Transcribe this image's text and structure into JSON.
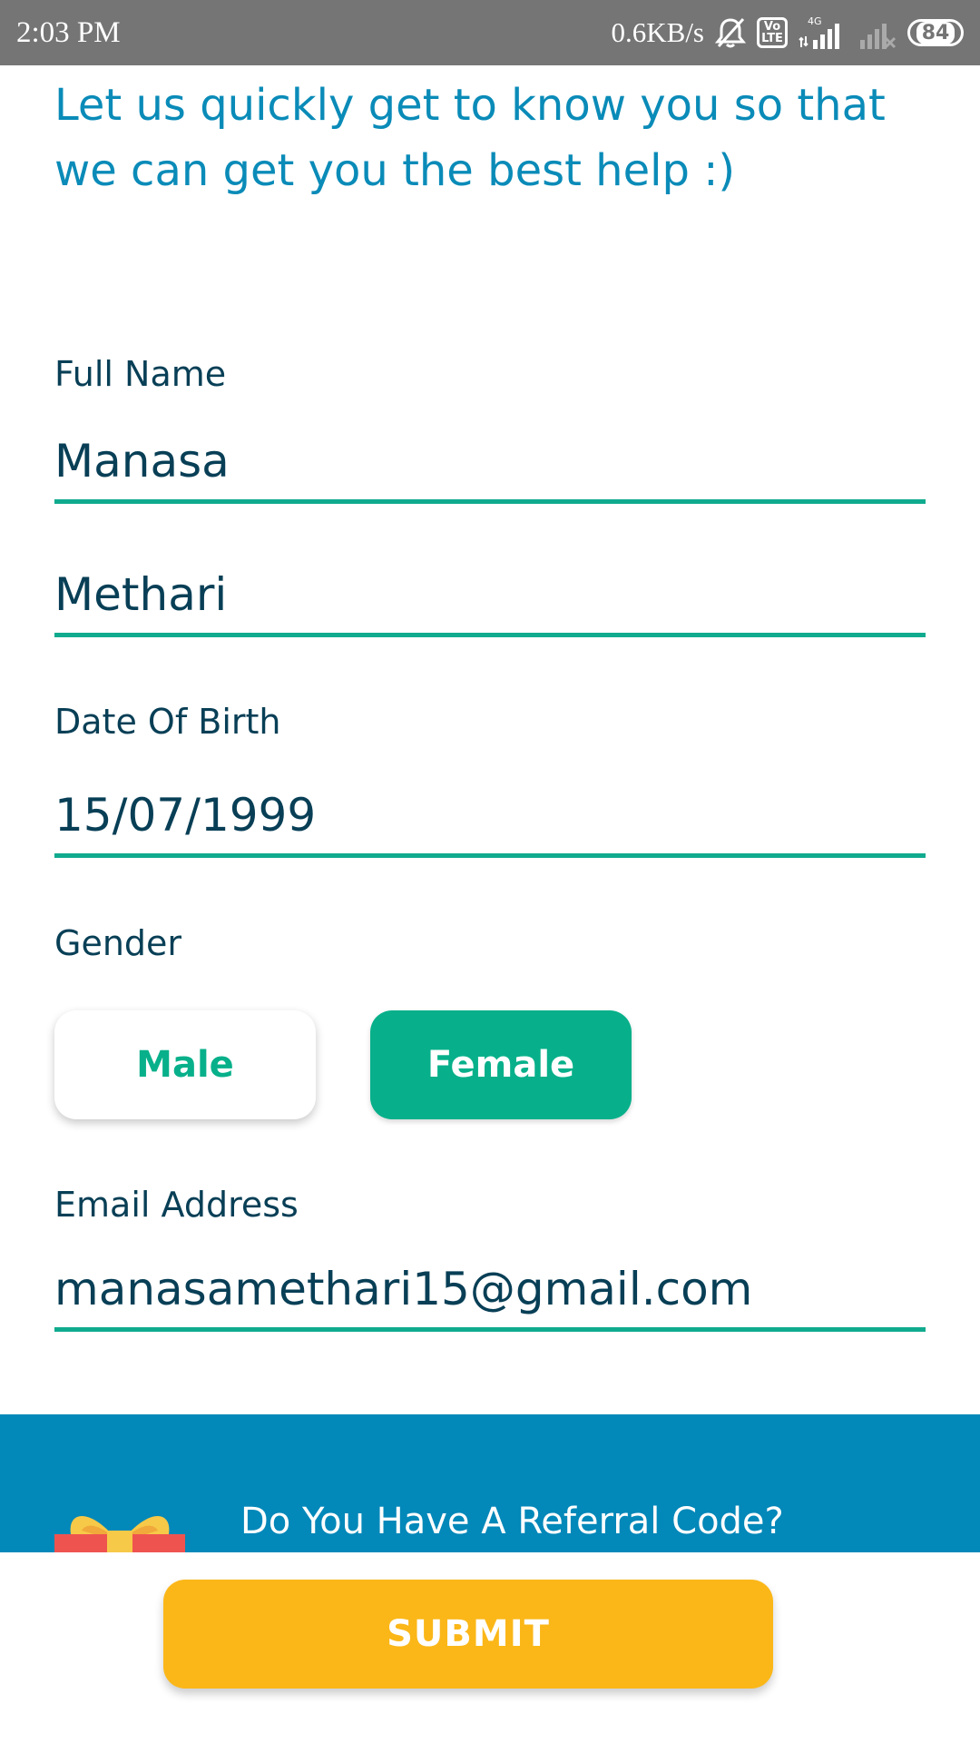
{
  "status_bar": {
    "time": "2:03 PM",
    "net_speed": "0.6KB/s",
    "network_type": "4G",
    "volte_top": "Vo",
    "volte_bottom": "LTE",
    "battery": "84",
    "icons": [
      "mute-bell-icon",
      "volte-icon",
      "signal-4g-icon",
      "signal-no-service-icon",
      "battery-icon"
    ]
  },
  "intro": {
    "text": "Let us quickly get to know you so that we can get you the best help :)"
  },
  "form": {
    "full_name_label": "Full Name",
    "first_name": "Manasa",
    "last_name": "Methari",
    "dob_label": "Date Of Birth",
    "dob": "15/07/1999",
    "gender_label": "Gender",
    "gender_options": [
      "Male",
      "Female"
    ],
    "gender_selected": "Female",
    "email_label": "Email Address",
    "email": "manasamethari15@gmail.com"
  },
  "referral": {
    "text": "Do You Have A Referral Code?",
    "icon": "gift-icon"
  },
  "submit": {
    "label": "SUBMIT"
  },
  "colors": {
    "status_bar": "#757575",
    "intro_text": "#0a8bb8",
    "label_text": "#083f56",
    "accent_green": "#07b08a",
    "underline": "#10ab8e",
    "referral_bg": "#0288b9",
    "submit_bg": "#fbb718"
  }
}
